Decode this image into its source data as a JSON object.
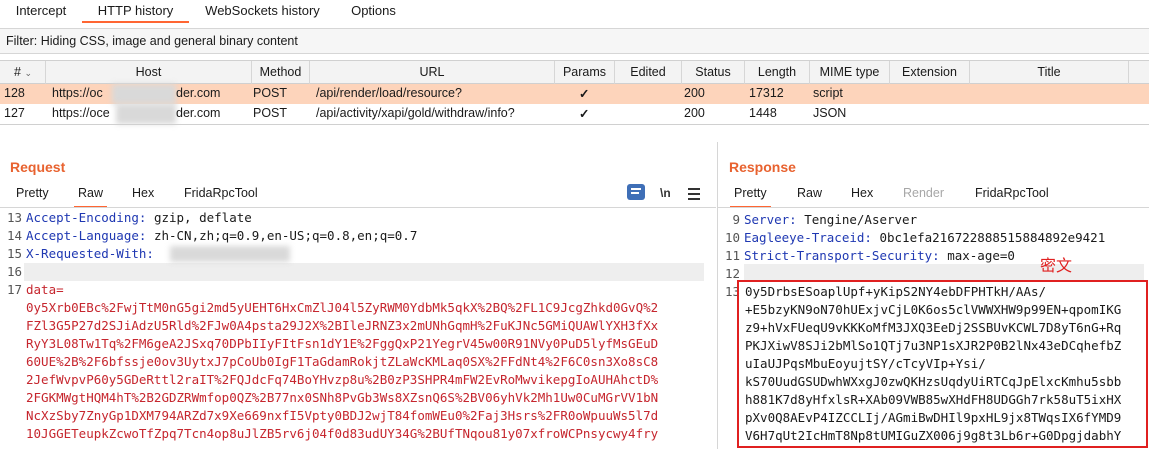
{
  "tabs": [
    "Intercept",
    "HTTP history",
    "WebSockets history",
    "Options"
  ],
  "filter": "Filter: Hiding CSS, image and general binary content",
  "table": {
    "columns": [
      "#",
      "Host",
      "Method",
      "URL",
      "Params",
      "Edited",
      "Status",
      "Length",
      "MIME type",
      "Extension",
      "Title"
    ],
    "rows": [
      {
        "num": "128",
        "host_prefix": "https://oc",
        "host_suffix": "der.com",
        "method": "POST",
        "url": "/api/render/load/resource?",
        "params": "✓",
        "edited": "",
        "status": "200",
        "length": "17312",
        "mime": "script",
        "extension": "",
        "title": ""
      },
      {
        "num": "127",
        "host_prefix": "https://oce",
        "host_suffix": "der.com",
        "method": "POST",
        "url": "/api/activity/xapi/gold/withdraw/info?",
        "params": "✓",
        "edited": "",
        "status": "200",
        "length": "1448",
        "mime": "JSON",
        "extension": "",
        "title": ""
      }
    ]
  },
  "request": {
    "title": "Request",
    "tabs": [
      "Pretty",
      "Raw",
      "Hex",
      "FridaRpcTool"
    ],
    "active_tab": "Raw",
    "line_numbers": [
      "13",
      "14",
      "15",
      "16",
      "17"
    ],
    "headers": [
      {
        "name": "Accept-Encoding:",
        "value": " gzip, deflate"
      },
      {
        "name": "Accept-Language:",
        "value": " zh-CN,zh;q=0.9,en-US;q=0.8,en;q=0.7"
      },
      {
        "name": "X-Requested-With:",
        "value": ""
      }
    ],
    "body_label": "data=",
    "body_lines": [
      "0y5Xrb0EBc%2FwjTtM0nG5gi2md5yUEHT6HxCmZlJ04l5ZyRWM0YdbMk5qkX%2BQ%2FL1C9JcgZhkd0GvQ%2",
      "FZl3G5P27d2SJiAdzU5Rld%2FJw0A4psta29J2X%2BIleJRNZ3x2mUNhGqmH%2FuKJNc5GMiQUAWlYXH3fXx",
      "RyY3L08Tw1Tq%2FM6geA2JSxq70DPbIIyFItFsn1dY1E%2FggQxP21YegrV45w00R91NVy0PuD5lyfMsGEuD",
      "60UE%2B%2F6bfssje0ov3UytxJ7pCoUb0IgF1TaGdamRokjtZLaWcKMLaq0SX%2FFdNt4%2F6C0sn3Xo8sC8",
      "2JefWvpvP60y5GDeRttl2raIT%2FQJdcFq74BoYHvzp8u%2B0zP3SHPR4mFW2EvRoMwvikepgIoAUHAhctD%",
      "2FGKMWgtHQM4hT%2B2GDZRWmfop0QZ%2B77nx0SNh8PvGb3Ws8XZsnQ6S%2BV06yhVk2Mh1Uw0CuMGrVV1bN",
      "NcXzSby7ZnyGp1DXM794ARZd7x9Xe669nxfI5Vpty0BDJ2wjT84fomWEu0%2Faj3Hsrs%2FR0oWpuuWs5l7d",
      "10JGGETeupkZcwoTfZpq7Tcn4op8uJlZB5rv6j04f0d83udUY34G%2BUfTNqou81y07xfroWCPnsycwy4fry"
    ]
  },
  "response": {
    "title": "Response",
    "tabs": [
      "Pretty",
      "Raw",
      "Hex",
      "Render",
      "FridaRpcTool"
    ],
    "active_tab": "Pretty",
    "line_numbers": [
      "9",
      "10",
      "11",
      "12",
      "13"
    ],
    "headers": [
      {
        "name": "Server:",
        "value": " Tengine/Aserver"
      },
      {
        "name": "Eagleeye-Traceid:",
        "value": " 0bc1efa216722888515884892e9421"
      },
      {
        "name": "Strict-Transport-Security:",
        "value": " max-age=0"
      }
    ],
    "annotation": "密文",
    "body_lines": [
      "0y5DrbsESoaplUpf+yKipS2NY4ebDFPHTkH/AAs/",
      "+E5bzyKN9oN70hUExjvCjL0K6os5clVWWXHW9p99EN+qpomIKG",
      "z9+hVxFUeqU9vKKKoMfM3JXQ3EeDj2SSBUvKCWL7D8yT6nG+Rq",
      "PKJXiwV8SJi2bMlSo1QTj7u3NP1sXJR2P0B2lNx43eDCqhefbZ",
      "uIaUJPqsMbuEoyujtSY/cTcyVIp+Ysi/",
      "kS70UudGSUDwhWXxgJ0zwQKHzsUqdyUiRTCqJpElxcKmhu5sbb",
      "h881K7d8yHfxlsR+XAb09VWB85wXHdFH8UDGGh7rk58uT5ixHX",
      "pXv0Q8AEvP4IZCCLIj/AGmiBwDHIl9pxHL9jx8TWqsIX6fYMD9",
      "V6H7qUt2IcHmT8Np8tUMIGuZX006j9g8t3Lb6r+G0DpgjdabhY"
    ]
  }
}
